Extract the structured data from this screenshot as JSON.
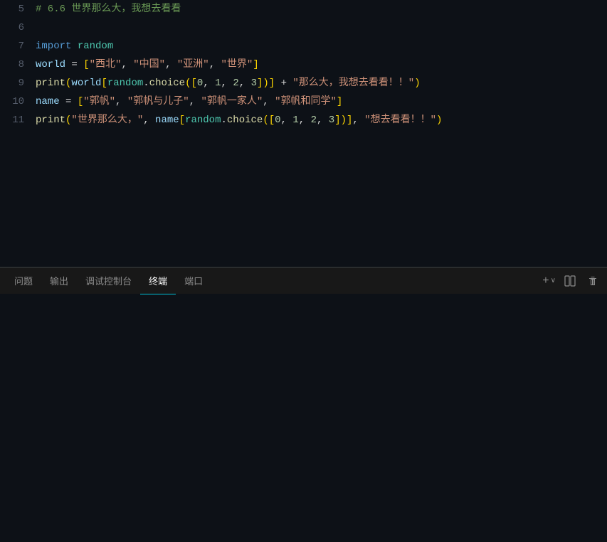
{
  "editor": {
    "background": "#0d1117",
    "lines": [
      {
        "number": "5",
        "tokens": [
          {
            "text": "# 6.6 世界那么大，我想去看看",
            "class": "kw-comment"
          }
        ]
      },
      {
        "number": "6",
        "tokens": []
      },
      {
        "number": "7",
        "tokens": [
          {
            "text": "import",
            "class": "kw-import"
          },
          {
            "text": " ",
            "class": "kw-op"
          },
          {
            "text": "random",
            "class": "kw-module"
          }
        ]
      },
      {
        "number": "8",
        "tokens": [
          {
            "text": "world",
            "class": "kw-var"
          },
          {
            "text": " = ",
            "class": "kw-op"
          },
          {
            "text": "[",
            "class": "kw-bracket"
          },
          {
            "text": "\"西北\"",
            "class": "kw-string"
          },
          {
            "text": ", ",
            "class": "kw-op"
          },
          {
            "text": "\"中国\"",
            "class": "kw-string"
          },
          {
            "text": ", ",
            "class": "kw-op"
          },
          {
            "text": "\"亚洲\"",
            "class": "kw-string"
          },
          {
            "text": ", ",
            "class": "kw-op"
          },
          {
            "text": "\"世界\"",
            "class": "kw-string"
          },
          {
            "text": "]",
            "class": "kw-bracket"
          }
        ]
      },
      {
        "number": "9",
        "tokens": [
          {
            "text": "print",
            "class": "kw-func"
          },
          {
            "text": "(",
            "class": "kw-bracket"
          },
          {
            "text": "world",
            "class": "kw-var"
          },
          {
            "text": "[",
            "class": "kw-bracket"
          },
          {
            "text": "random",
            "class": "kw-random"
          },
          {
            "text": ".",
            "class": "kw-op"
          },
          {
            "text": "choice",
            "class": "kw-func"
          },
          {
            "text": "([",
            "class": "kw-bracket"
          },
          {
            "text": "0",
            "class": "kw-number"
          },
          {
            "text": ", ",
            "class": "kw-op"
          },
          {
            "text": "1",
            "class": "kw-number"
          },
          {
            "text": ", ",
            "class": "kw-op"
          },
          {
            "text": "2",
            "class": "kw-number"
          },
          {
            "text": ", ",
            "class": "kw-op"
          },
          {
            "text": "3",
            "class": "kw-number"
          },
          {
            "text": "])",
            "class": "kw-bracket"
          },
          {
            "text": "]",
            "class": "kw-bracket"
          },
          {
            "text": " + ",
            "class": "kw-op"
          },
          {
            "text": "\"那么大，我想去看看！！\"",
            "class": "kw-string"
          },
          {
            "text": ")",
            "class": "kw-bracket"
          }
        ]
      },
      {
        "number": "10",
        "tokens": [
          {
            "text": "name",
            "class": "kw-var"
          },
          {
            "text": " = ",
            "class": "kw-op"
          },
          {
            "text": "[",
            "class": "kw-bracket"
          },
          {
            "text": "\"郭帆\"",
            "class": "kw-string"
          },
          {
            "text": ", ",
            "class": "kw-op"
          },
          {
            "text": "\"郭帆与儿子\"",
            "class": "kw-string"
          },
          {
            "text": ", ",
            "class": "kw-op"
          },
          {
            "text": "\"郭帆一家人\"",
            "class": "kw-string"
          },
          {
            "text": ", ",
            "class": "kw-op"
          },
          {
            "text": "\"郭帆和同学\"",
            "class": "kw-string"
          },
          {
            "text": "]",
            "class": "kw-bracket"
          }
        ]
      },
      {
        "number": "11",
        "tokens": [
          {
            "text": "print",
            "class": "kw-func"
          },
          {
            "text": "(",
            "class": "kw-bracket"
          },
          {
            "text": "\"世界那么大，\"",
            "class": "kw-string"
          },
          {
            "text": ", ",
            "class": "kw-op"
          },
          {
            "text": "name",
            "class": "kw-var"
          },
          {
            "text": "[",
            "class": "kw-bracket"
          },
          {
            "text": "random",
            "class": "kw-random"
          },
          {
            "text": ".",
            "class": "kw-op"
          },
          {
            "text": "choice",
            "class": "kw-func"
          },
          {
            "text": "([",
            "class": "kw-bracket"
          },
          {
            "text": "0",
            "class": "kw-number"
          },
          {
            "text": ", ",
            "class": "kw-op"
          },
          {
            "text": "1",
            "class": "kw-number"
          },
          {
            "text": ", ",
            "class": "kw-op"
          },
          {
            "text": "2",
            "class": "kw-number"
          },
          {
            "text": ", ",
            "class": "kw-op"
          },
          {
            "text": "3",
            "class": "kw-number"
          },
          {
            "text": "])",
            "class": "kw-bracket"
          },
          {
            "text": "]",
            "class": "kw-bracket"
          },
          {
            "text": ", ",
            "class": "kw-op"
          },
          {
            "text": "\"想去看看！！\"",
            "class": "kw-string"
          },
          {
            "text": ")",
            "class": "kw-bracket"
          }
        ]
      }
    ]
  },
  "panel": {
    "tabs": [
      {
        "label": "问题",
        "active": false
      },
      {
        "label": "输出",
        "active": false
      },
      {
        "label": "调试控制台",
        "active": false
      },
      {
        "label": "终端",
        "active": true
      },
      {
        "label": "端口",
        "active": false
      }
    ],
    "actions": {
      "add_label": "+",
      "chevron_label": "∨",
      "split_label": "⧉",
      "trash_label": "🗑"
    }
  }
}
